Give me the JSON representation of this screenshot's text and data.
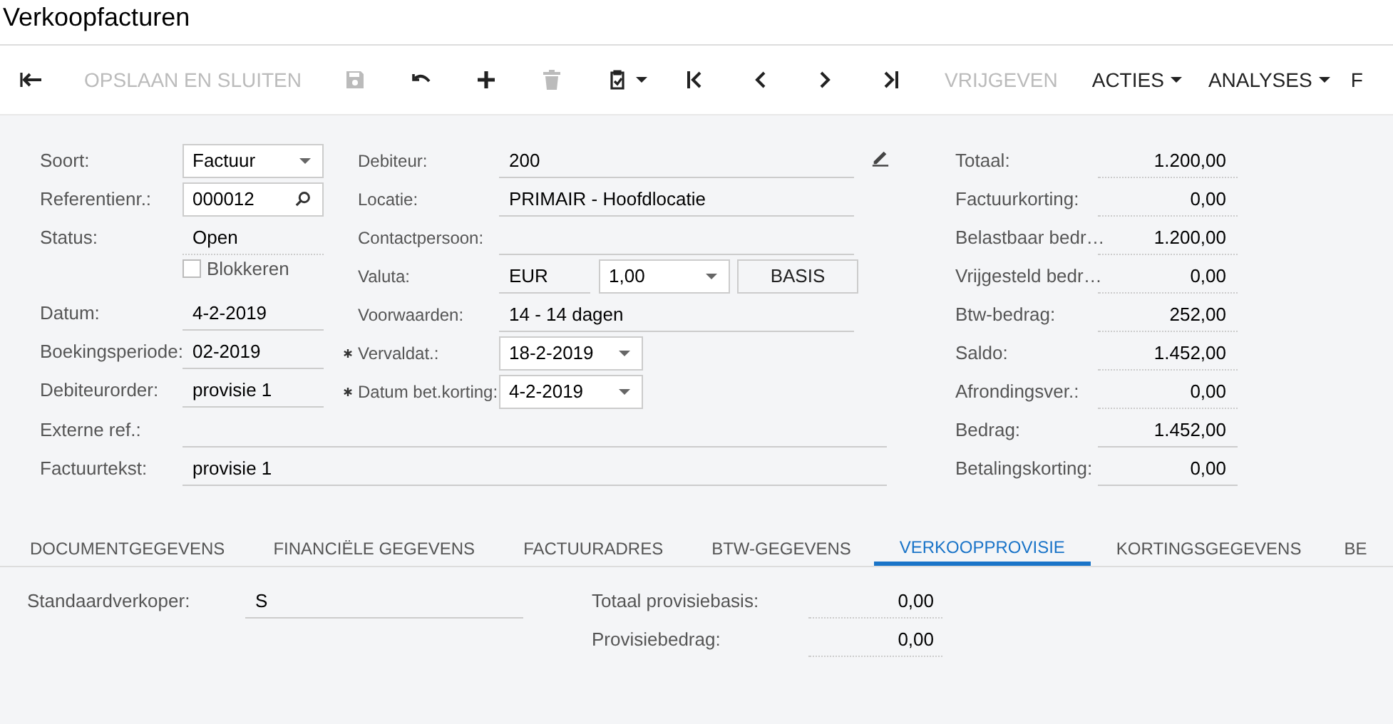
{
  "title": "Verkoopfacturen",
  "toolbar": [
    {
      "kind": "back",
      "disabled": false
    },
    {
      "kind": "text",
      "label": "OPSLAAN EN SLUITEN",
      "disabled": true
    },
    {
      "kind": "save",
      "disabled": true
    },
    {
      "kind": "undo",
      "disabled": false
    },
    {
      "kind": "add",
      "disabled": false
    },
    {
      "kind": "delete",
      "disabled": true
    },
    {
      "kind": "clipboard",
      "disabled": false
    },
    {
      "kind": "first",
      "disabled": false
    },
    {
      "kind": "prev",
      "disabled": false
    },
    {
      "kind": "next",
      "disabled": false
    },
    {
      "kind": "last",
      "disabled": false
    },
    {
      "kind": "text",
      "label": "VRIJGEVEN",
      "disabled": true
    },
    {
      "kind": "menu",
      "label": "ACTIES",
      "disabled": false
    },
    {
      "kind": "menu",
      "label": "ANALYSES",
      "disabled": false
    },
    {
      "kind": "text",
      "label": "F",
      "disabled": false
    }
  ],
  "left": [
    {
      "kind": "select",
      "label": "Soort:",
      "value": "Factuur"
    },
    {
      "kind": "search",
      "label": "Referentienr.:",
      "value": "000012"
    },
    {
      "kind": "text",
      "label": "Status:",
      "value": "Open",
      "readonly": true
    },
    {
      "kind": "checkbox",
      "label": "Blokkeren",
      "checked": false
    },
    {
      "kind": "text",
      "label": "Datum:",
      "value": "4-2-2019",
      "readonly": false
    },
    {
      "kind": "text",
      "label": "Boekingsperiode:",
      "value": "02-2019",
      "readonly": false
    },
    {
      "kind": "text",
      "label": "Debiteurorder:",
      "value": "provisie 1",
      "readonly": false
    }
  ],
  "middle": [
    {
      "kind": "text",
      "label": "Debiteur:",
      "value": "200",
      "readonly": false,
      "edit": true
    },
    {
      "kind": "text",
      "label": "Locatie:",
      "value": "PRIMAIR - Hoofdlocatie",
      "readonly": false
    },
    {
      "kind": "text",
      "label": "Contactpersoon:",
      "readonly": false
    },
    {
      "kind": "currency",
      "label": "Valuta:",
      "value": "EUR",
      "rate": "1,00",
      "button": "BASIS"
    },
    {
      "kind": "text",
      "label": "Voorwaarden:",
      "value": "14 - 14 dagen",
      "readonly": false
    },
    {
      "kind": "date",
      "label": "Vervaldat.:",
      "value": "18-2-2019",
      "required": true
    },
    {
      "kind": "date",
      "label": "Datum bet.korting:",
      "value": "4-2-2019",
      "required": true
    }
  ],
  "wide": [
    {
      "label": "Externe ref.:"
    },
    {
      "label": "Factuurtekst:",
      "value": "provisie 1"
    }
  ],
  "totals": [
    {
      "label": "Totaal:",
      "value": "1.200,00",
      "readonly": true
    },
    {
      "label": "Factuurkorting:",
      "value": "0,00",
      "readonly": true
    },
    {
      "label": "Belastbaar bedr…",
      "value": "1.200,00",
      "readonly": true
    },
    {
      "label": "Vrijgesteld bedr…",
      "value": "0,00",
      "readonly": true
    },
    {
      "label": "Btw-bedrag:",
      "value": "252,00",
      "readonly": true
    },
    {
      "label": "Saldo:",
      "value": "1.452,00",
      "readonly": true
    },
    {
      "label": "Afrondingsver.:",
      "value": "0,00",
      "readonly": true
    },
    {
      "label": "Bedrag:",
      "value": "1.452,00",
      "readonly": false
    },
    {
      "label": "Betalingskorting:",
      "value": "0,00",
      "readonly": false
    }
  ],
  "tabs": [
    {
      "label": "DOCUMENTGEGEVENS",
      "selected": false
    },
    {
      "label": "FINANCIËLE GEGEVENS",
      "selected": false
    },
    {
      "label": "FACTUURADRES",
      "selected": false
    },
    {
      "label": "BTW-GEGEVENS",
      "selected": false
    },
    {
      "label": "VERKOOPPROVISIE",
      "selected": true
    },
    {
      "label": "KORTINGSGEGEVENS",
      "selected": false
    },
    {
      "label": "BE",
      "selected": false
    }
  ],
  "commission": {
    "salesperson": {
      "label": "Standaardverkoper:",
      "value": "S",
      "readonly": false
    },
    "amounts": [
      {
        "label": "Totaal provisiebasis:",
        "value": "0,00",
        "readonly": true
      },
      {
        "label": "Provisiebedrag:",
        "value": "0,00",
        "readonly": true
      }
    ]
  }
}
